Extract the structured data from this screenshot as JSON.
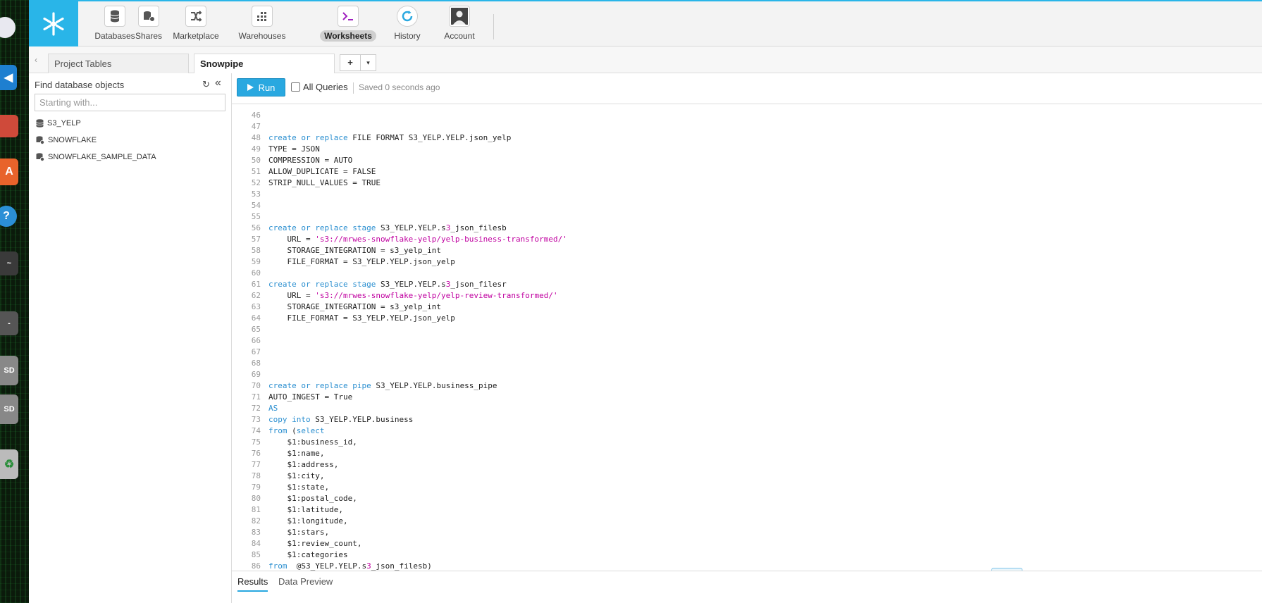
{
  "nav": {
    "items": [
      {
        "label": "Databases",
        "icon": "database-icon"
      },
      {
        "label": "Shares",
        "icon": "shares-icon"
      },
      {
        "label": "Marketplace",
        "icon": "marketplace-icon"
      },
      {
        "label": "Warehouses",
        "icon": "warehouses-icon"
      },
      {
        "label": "Worksheets",
        "icon": "terminal-icon",
        "active": true
      },
      {
        "label": "History",
        "icon": "history-icon"
      },
      {
        "label": "Account",
        "icon": "account-icon"
      }
    ]
  },
  "tabs": {
    "items": [
      "Project Tables",
      "Snowpipe"
    ],
    "active": "Snowpipe",
    "add_label": "+",
    "menu_label": "▾"
  },
  "sidebar": {
    "title": "Find database objects",
    "search_placeholder": "Starting with...",
    "databases": [
      "S3_YELP",
      "SNOWFLAKE",
      "SNOWFLAKE_SAMPLE_DATA"
    ]
  },
  "toolbar": {
    "run_label": "Run",
    "all_queries_label": "All Queries",
    "all_queries_checked": false,
    "saved_status": "Saved 0 seconds ago"
  },
  "editor": {
    "lines": [
      {
        "n": "46",
        "t": ""
      },
      {
        "n": "47",
        "t": ""
      },
      {
        "n": "48",
        "t": "create or replace FILE FORMAT S3_YELP.YELP.json_yelp"
      },
      {
        "n": "49",
        "t": "TYPE = JSON"
      },
      {
        "n": "50",
        "t": "COMPRESSION = AUTO"
      },
      {
        "n": "51",
        "t": "ALLOW_DUPLICATE = FALSE"
      },
      {
        "n": "52",
        "t": "STRIP_NULL_VALUES = TRUE"
      },
      {
        "n": "53",
        "t": ""
      },
      {
        "n": "54",
        "t": ""
      },
      {
        "n": "55",
        "t": ""
      },
      {
        "n": "56",
        "t": "create or replace stage S3_YELP.YELP.s3_json_filesb"
      },
      {
        "n": "57",
        "t": "    URL = 's3://mrwes-snowflake-yelp/yelp-business-transformed/'"
      },
      {
        "n": "58",
        "t": "    STORAGE_INTEGRATION = s3_yelp_int"
      },
      {
        "n": "59",
        "t": "    FILE_FORMAT = S3_YELP.YELP.json_yelp"
      },
      {
        "n": "60",
        "t": ""
      },
      {
        "n": "61",
        "t": "create or replace stage S3_YELP.YELP.s3_json_filesr"
      },
      {
        "n": "62",
        "t": "    URL = 's3://mrwes-snowflake-yelp/yelp-review-transformed/'"
      },
      {
        "n": "63",
        "t": "    STORAGE_INTEGRATION = s3_yelp_int"
      },
      {
        "n": "64",
        "t": "    FILE_FORMAT = S3_YELP.YELP.json_yelp"
      },
      {
        "n": "65",
        "t": ""
      },
      {
        "n": "66",
        "t": ""
      },
      {
        "n": "67",
        "t": ""
      },
      {
        "n": "68",
        "t": ""
      },
      {
        "n": "69",
        "t": ""
      },
      {
        "n": "70",
        "t": "create or replace pipe S3_YELP.YELP.business_pipe"
      },
      {
        "n": "71",
        "t": "AUTO_INGEST = True"
      },
      {
        "n": "72",
        "t": "AS"
      },
      {
        "n": "73",
        "t": "copy into S3_YELP.YELP.business"
      },
      {
        "n": "74",
        "t": "from (select"
      },
      {
        "n": "75",
        "t": "    $1:business_id,"
      },
      {
        "n": "76",
        "t": "    $1:name,"
      },
      {
        "n": "77",
        "t": "    $1:address,"
      },
      {
        "n": "78",
        "t": "    $1:city,"
      },
      {
        "n": "79",
        "t": "    $1:state,"
      },
      {
        "n": "80",
        "t": "    $1:postal_code,"
      },
      {
        "n": "81",
        "t": "    $1:latitude,"
      },
      {
        "n": "82",
        "t": "    $1:longitude,"
      },
      {
        "n": "83",
        "t": "    $1:stars,"
      },
      {
        "n": "84",
        "t": "    $1:review_count,"
      },
      {
        "n": "85",
        "t": "    $1:categories"
      },
      {
        "n": "86",
        "t": "from  @S3_YELP.YELP.s3_json_filesb)"
      }
    ]
  },
  "results": {
    "tabs": [
      "Results",
      "Data Preview"
    ],
    "active": "Results"
  },
  "colors": {
    "accent": "#29b5e8",
    "keyword": "#2b8fd0",
    "string": "#c000a0"
  }
}
